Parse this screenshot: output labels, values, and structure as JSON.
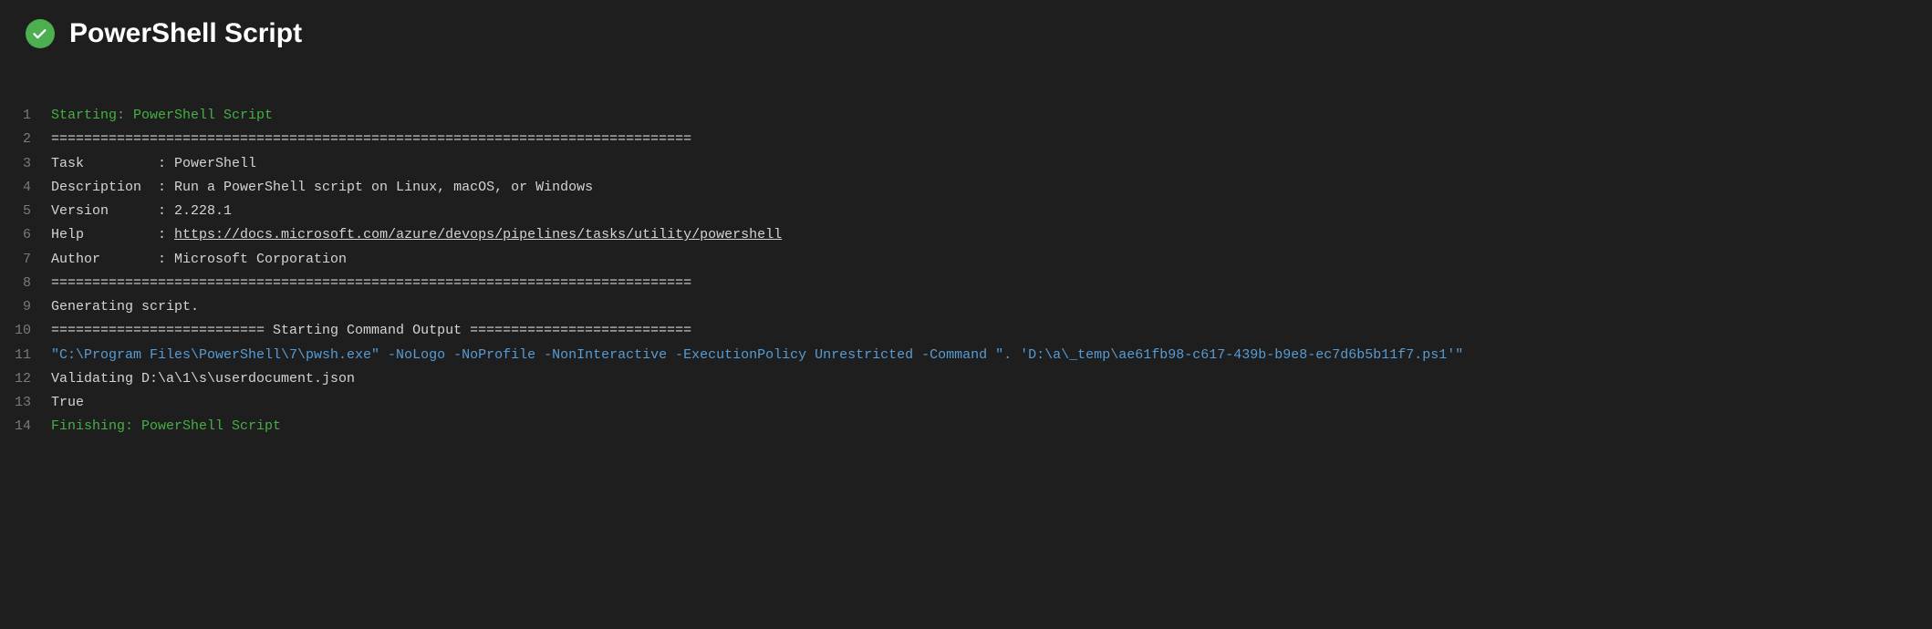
{
  "header": {
    "title": "PowerShell Script"
  },
  "log": {
    "lines": [
      {
        "num": "1",
        "text": "Starting: PowerShell Script",
        "cls": "c-green"
      },
      {
        "num": "2",
        "text": "==============================================================================",
        "cls": ""
      },
      {
        "num": "3",
        "text": "Task         : PowerShell",
        "cls": ""
      },
      {
        "num": "4",
        "text": "Description  : Run a PowerShell script on Linux, macOS, or Windows",
        "cls": ""
      },
      {
        "num": "5",
        "text": "Version      : 2.228.1",
        "cls": ""
      },
      {
        "num": "6",
        "prefix": "Help         : ",
        "link": "https://docs.microsoft.com/azure/devops/pipelines/tasks/utility/powershell",
        "cls": ""
      },
      {
        "num": "7",
        "text": "Author       : Microsoft Corporation",
        "cls": ""
      },
      {
        "num": "8",
        "text": "==============================================================================",
        "cls": ""
      },
      {
        "num": "9",
        "text": "Generating script.",
        "cls": ""
      },
      {
        "num": "10",
        "text": "========================== Starting Command Output ===========================",
        "cls": ""
      },
      {
        "num": "11",
        "text": "\"C:\\Program Files\\PowerShell\\7\\pwsh.exe\" -NoLogo -NoProfile -NonInteractive -ExecutionPolicy Unrestricted -Command \". 'D:\\a\\_temp\\ae61fb98-c617-439b-b9e8-ec7d6b5b11f7.ps1'\"",
        "cls": "c-blue"
      },
      {
        "num": "12",
        "text": "Validating D:\\a\\1\\s\\userdocument.json",
        "cls": ""
      },
      {
        "num": "13",
        "text": "True",
        "cls": ""
      },
      {
        "num": "14",
        "text": "Finishing: PowerShell Script",
        "cls": "c-green"
      }
    ]
  }
}
